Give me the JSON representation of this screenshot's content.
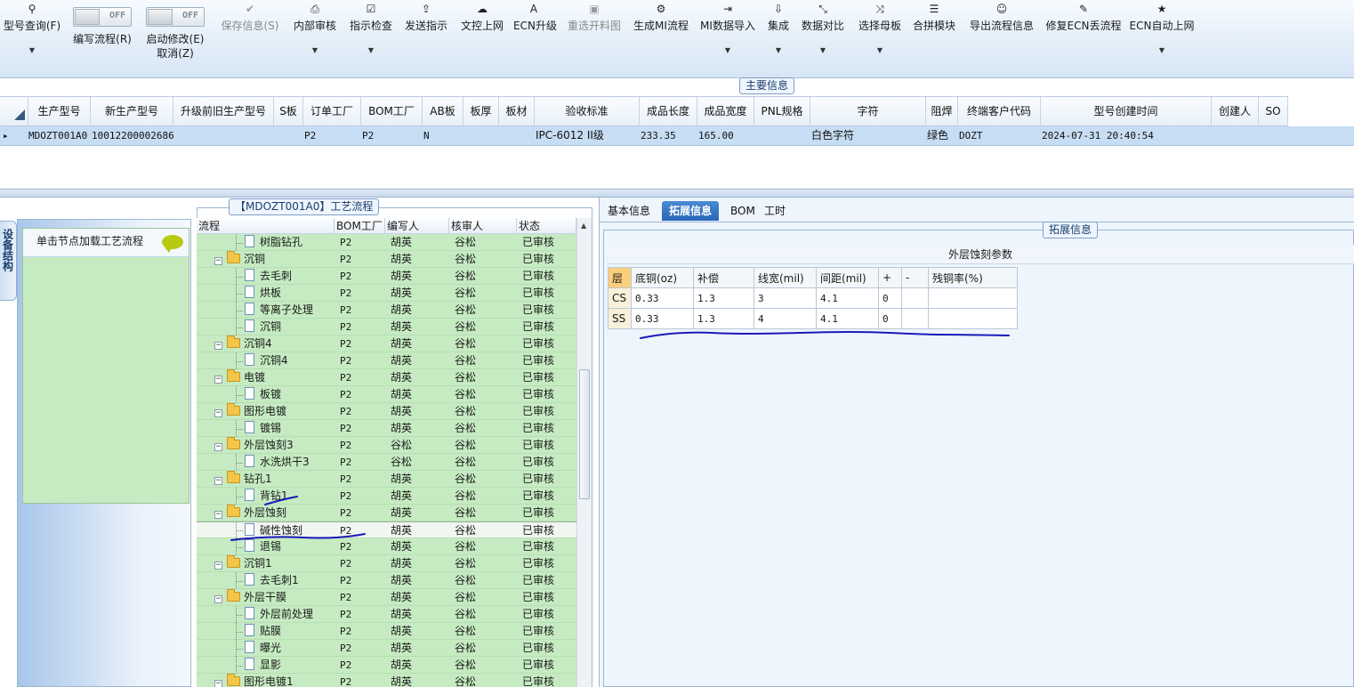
{
  "toolbar": {
    "buttons": [
      {
        "icon": "search-icon",
        "label": "型号查询(F)",
        "has_dropdown": true
      },
      {
        "icon": "save-icon",
        "label": "保存信息(S)",
        "disabled": true
      },
      {
        "icon": "print-icon",
        "label": "内部审核",
        "has_dropdown": true
      },
      {
        "icon": "check-icon",
        "label": "指示检查",
        "has_dropdown": true
      },
      {
        "icon": "upload-icon",
        "label": "发送指示"
      },
      {
        "icon": "cloud-upload-icon",
        "label": "文控上网"
      },
      {
        "icon": "font-icon",
        "label": "ECN升级"
      },
      {
        "icon": "picture-icon",
        "label": "重选开料图",
        "disabled": true
      },
      {
        "icon": "cogs-icon",
        "label": "生成MI流程"
      },
      {
        "icon": "sign-in-icon",
        "label": "MI数据导入",
        "has_dropdown": true
      },
      {
        "icon": "download-icon",
        "label": "集成",
        "has_dropdown": true
      },
      {
        "icon": "compress-icon",
        "label": "数据对比",
        "has_dropdown": true
      },
      {
        "icon": "shuffle-icon",
        "label": "选择母板",
        "has_dropdown": true
      },
      {
        "icon": "list-icon",
        "label": "合拼模块"
      },
      {
        "icon": "smile-icon",
        "label": "导出流程信息"
      },
      {
        "icon": "wrench-icon",
        "label": "修复ECN丢流程"
      },
      {
        "icon": "star-icon",
        "label": "ECN自动上网",
        "has_dropdown": true
      }
    ],
    "toggles": [
      {
        "state": "OFF",
        "label": "编写流程(R)"
      },
      {
        "state": "OFF",
        "label": "启动修改(E)",
        "label2": "取消(Z)"
      }
    ]
  },
  "main_info": {
    "title": "主要信息",
    "columns": [
      "生产型号",
      "新生产型号",
      "升级前旧生产型号",
      "S板",
      "订单工厂",
      "BOM工厂",
      "AB板",
      "板厚",
      "板材",
      "验收标准",
      "成品长度",
      "成品宽度",
      "PNL规格",
      "字符",
      "阻焊",
      "终端客户代码",
      "型号创建时间",
      "创建人",
      "SO"
    ],
    "row": [
      "MDOZT001A0",
      "10012200002686",
      "",
      "",
      "P2",
      "P2",
      "N",
      "",
      "",
      "IPC-6012 II级",
      "233.35",
      "165.00",
      "",
      "白色字符",
      "绿色",
      "DOZT",
      "2024-07-31 20:40:54",
      "",
      ""
    ]
  },
  "side_tab": {
    "label": "设备结构"
  },
  "left_panel": {
    "load_hint": "单击节点加载工艺流程"
  },
  "process": {
    "title": "【MDOZT001A0】工艺流程",
    "columns": [
      "流程",
      "BOM工厂",
      "编写人",
      "核审人",
      "状态"
    ],
    "rows": [
      {
        "level": 2,
        "name": "树脂钻孔",
        "bom": "P2",
        "writer": "胡英",
        "reviewer": "谷松",
        "status": "已审核"
      },
      {
        "level": 1,
        "name": "沉铜",
        "bom": "P2",
        "writer": "胡英",
        "reviewer": "谷松",
        "status": "已审核"
      },
      {
        "level": 2,
        "name": "去毛刺",
        "bom": "P2",
        "writer": "胡英",
        "reviewer": "谷松",
        "status": "已审核"
      },
      {
        "level": 2,
        "name": "烘板",
        "bom": "P2",
        "writer": "胡英",
        "reviewer": "谷松",
        "status": "已审核"
      },
      {
        "level": 2,
        "name": "等离子处理",
        "bom": "P2",
        "writer": "胡英",
        "reviewer": "谷松",
        "status": "已审核"
      },
      {
        "level": 2,
        "name": "沉铜",
        "bom": "P2",
        "writer": "胡英",
        "reviewer": "谷松",
        "status": "已审核"
      },
      {
        "level": 1,
        "name": "沉铜4",
        "bom": "P2",
        "writer": "胡英",
        "reviewer": "谷松",
        "status": "已审核"
      },
      {
        "level": 2,
        "name": "沉铜4",
        "bom": "P2",
        "writer": "胡英",
        "reviewer": "谷松",
        "status": "已审核"
      },
      {
        "level": 1,
        "name": "电镀",
        "bom": "P2",
        "writer": "胡英",
        "reviewer": "谷松",
        "status": "已审核"
      },
      {
        "level": 2,
        "name": "板镀",
        "bom": "P2",
        "writer": "胡英",
        "reviewer": "谷松",
        "status": "已审核"
      },
      {
        "level": 1,
        "name": "图形电镀",
        "bom": "P2",
        "writer": "胡英",
        "reviewer": "谷松",
        "status": "已审核"
      },
      {
        "level": 2,
        "name": "镀锡",
        "bom": "P2",
        "writer": "胡英",
        "reviewer": "谷松",
        "status": "已审核"
      },
      {
        "level": 1,
        "name": "外层蚀刻3",
        "bom": "P2",
        "writer": "谷松",
        "reviewer": "谷松",
        "status": "已审核"
      },
      {
        "level": 2,
        "name": "水洗烘干3",
        "bom": "P2",
        "writer": "谷松",
        "reviewer": "谷松",
        "status": "已审核"
      },
      {
        "level": 1,
        "name": "钻孔1",
        "bom": "P2",
        "writer": "胡英",
        "reviewer": "谷松",
        "status": "已审核"
      },
      {
        "level": 2,
        "name": "背钻1",
        "bom": "P2",
        "writer": "胡英",
        "reviewer": "谷松",
        "status": "已审核"
      },
      {
        "level": 1,
        "name": "外层蚀刻",
        "bom": "P2",
        "writer": "胡英",
        "reviewer": "谷松",
        "status": "已审核"
      },
      {
        "level": 2,
        "name": "碱性蚀刻",
        "bom": "P2",
        "writer": "胡英",
        "reviewer": "谷松",
        "status": "已审核",
        "selected": true
      },
      {
        "level": 2,
        "name": "退锡",
        "bom": "P2",
        "writer": "胡英",
        "reviewer": "谷松",
        "status": "已审核"
      },
      {
        "level": 1,
        "name": "沉铜1",
        "bom": "P2",
        "writer": "胡英",
        "reviewer": "谷松",
        "status": "已审核"
      },
      {
        "level": 2,
        "name": "去毛刺1",
        "bom": "P2",
        "writer": "胡英",
        "reviewer": "谷松",
        "status": "已审核"
      },
      {
        "level": 1,
        "name": "外层干膜",
        "bom": "P2",
        "writer": "胡英",
        "reviewer": "谷松",
        "status": "已审核"
      },
      {
        "level": 2,
        "name": "外层前处理",
        "bom": "P2",
        "writer": "胡英",
        "reviewer": "谷松",
        "status": "已审核"
      },
      {
        "level": 2,
        "name": "贴膜",
        "bom": "P2",
        "writer": "胡英",
        "reviewer": "谷松",
        "status": "已审核"
      },
      {
        "level": 2,
        "name": "曝光",
        "bom": "P2",
        "writer": "胡英",
        "reviewer": "谷松",
        "status": "已审核"
      },
      {
        "level": 2,
        "name": "显影",
        "bom": "P2",
        "writer": "胡英",
        "reviewer": "谷松",
        "status": "已审核"
      },
      {
        "level": 1,
        "name": "图形电镀1",
        "bom": "P2",
        "writer": "胡英",
        "reviewer": "谷松",
        "status": "已审核"
      }
    ]
  },
  "right_tabs": [
    {
      "label": "基本信息",
      "active": false
    },
    {
      "label": "拓展信息",
      "active": true
    },
    {
      "label": "BOM",
      "active": false
    },
    {
      "label": "工时",
      "active": false
    }
  ],
  "extension": {
    "title": "拓展信息",
    "param_title": "外层蚀刻参数",
    "columns": [
      "层",
      "底铜(oz)",
      "补偿",
      "线宽(mil)",
      "间距(mil)",
      "+",
      "-",
      "残铜率(%)"
    ],
    "rows": [
      [
        "CS",
        "0.33",
        "1.3",
        "3",
        "4.1",
        "0",
        "",
        ""
      ],
      [
        "SS",
        "0.33",
        "1.3",
        "4",
        "4.1",
        "0",
        "",
        ""
      ]
    ]
  },
  "colors": {
    "tree_bg": "#c6ebc2",
    "selected_row": "#c7ddf4",
    "active_tab": "#2f6fbf",
    "annotation_ink": "#1a1ab8"
  }
}
